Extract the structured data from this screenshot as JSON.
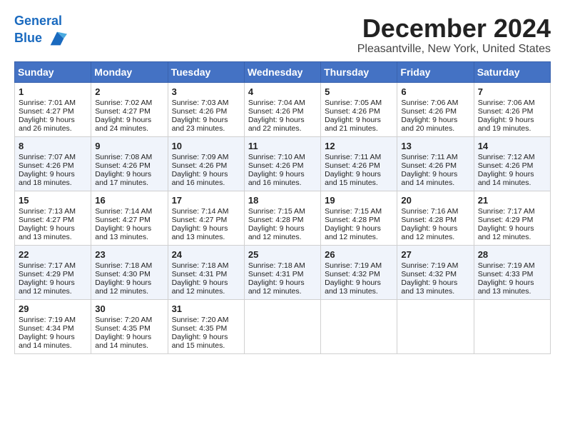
{
  "header": {
    "logo_line1": "General",
    "logo_line2": "Blue",
    "month_title": "December 2024",
    "location": "Pleasantville, New York, United States"
  },
  "days_of_week": [
    "Sunday",
    "Monday",
    "Tuesday",
    "Wednesday",
    "Thursday",
    "Friday",
    "Saturday"
  ],
  "weeks": [
    [
      {
        "day": "1",
        "sunrise": "Sunrise: 7:01 AM",
        "sunset": "Sunset: 4:27 PM",
        "daylight": "Daylight: 9 hours and 26 minutes."
      },
      {
        "day": "2",
        "sunrise": "Sunrise: 7:02 AM",
        "sunset": "Sunset: 4:27 PM",
        "daylight": "Daylight: 9 hours and 24 minutes."
      },
      {
        "day": "3",
        "sunrise": "Sunrise: 7:03 AM",
        "sunset": "Sunset: 4:26 PM",
        "daylight": "Daylight: 9 hours and 23 minutes."
      },
      {
        "day": "4",
        "sunrise": "Sunrise: 7:04 AM",
        "sunset": "Sunset: 4:26 PM",
        "daylight": "Daylight: 9 hours and 22 minutes."
      },
      {
        "day": "5",
        "sunrise": "Sunrise: 7:05 AM",
        "sunset": "Sunset: 4:26 PM",
        "daylight": "Daylight: 9 hours and 21 minutes."
      },
      {
        "day": "6",
        "sunrise": "Sunrise: 7:06 AM",
        "sunset": "Sunset: 4:26 PM",
        "daylight": "Daylight: 9 hours and 20 minutes."
      },
      {
        "day": "7",
        "sunrise": "Sunrise: 7:06 AM",
        "sunset": "Sunset: 4:26 PM",
        "daylight": "Daylight: 9 hours and 19 minutes."
      }
    ],
    [
      {
        "day": "8",
        "sunrise": "Sunrise: 7:07 AM",
        "sunset": "Sunset: 4:26 PM",
        "daylight": "Daylight: 9 hours and 18 minutes."
      },
      {
        "day": "9",
        "sunrise": "Sunrise: 7:08 AM",
        "sunset": "Sunset: 4:26 PM",
        "daylight": "Daylight: 9 hours and 17 minutes."
      },
      {
        "day": "10",
        "sunrise": "Sunrise: 7:09 AM",
        "sunset": "Sunset: 4:26 PM",
        "daylight": "Daylight: 9 hours and 16 minutes."
      },
      {
        "day": "11",
        "sunrise": "Sunrise: 7:10 AM",
        "sunset": "Sunset: 4:26 PM",
        "daylight": "Daylight: 9 hours and 16 minutes."
      },
      {
        "day": "12",
        "sunrise": "Sunrise: 7:11 AM",
        "sunset": "Sunset: 4:26 PM",
        "daylight": "Daylight: 9 hours and 15 minutes."
      },
      {
        "day": "13",
        "sunrise": "Sunrise: 7:11 AM",
        "sunset": "Sunset: 4:26 PM",
        "daylight": "Daylight: 9 hours and 14 minutes."
      },
      {
        "day": "14",
        "sunrise": "Sunrise: 7:12 AM",
        "sunset": "Sunset: 4:26 PM",
        "daylight": "Daylight: 9 hours and 14 minutes."
      }
    ],
    [
      {
        "day": "15",
        "sunrise": "Sunrise: 7:13 AM",
        "sunset": "Sunset: 4:27 PM",
        "daylight": "Daylight: 9 hours and 13 minutes."
      },
      {
        "day": "16",
        "sunrise": "Sunrise: 7:14 AM",
        "sunset": "Sunset: 4:27 PM",
        "daylight": "Daylight: 9 hours and 13 minutes."
      },
      {
        "day": "17",
        "sunrise": "Sunrise: 7:14 AM",
        "sunset": "Sunset: 4:27 PM",
        "daylight": "Daylight: 9 hours and 13 minutes."
      },
      {
        "day": "18",
        "sunrise": "Sunrise: 7:15 AM",
        "sunset": "Sunset: 4:28 PM",
        "daylight": "Daylight: 9 hours and 12 minutes."
      },
      {
        "day": "19",
        "sunrise": "Sunrise: 7:15 AM",
        "sunset": "Sunset: 4:28 PM",
        "daylight": "Daylight: 9 hours and 12 minutes."
      },
      {
        "day": "20",
        "sunrise": "Sunrise: 7:16 AM",
        "sunset": "Sunset: 4:28 PM",
        "daylight": "Daylight: 9 hours and 12 minutes."
      },
      {
        "day": "21",
        "sunrise": "Sunrise: 7:17 AM",
        "sunset": "Sunset: 4:29 PM",
        "daylight": "Daylight: 9 hours and 12 minutes."
      }
    ],
    [
      {
        "day": "22",
        "sunrise": "Sunrise: 7:17 AM",
        "sunset": "Sunset: 4:29 PM",
        "daylight": "Daylight: 9 hours and 12 minutes."
      },
      {
        "day": "23",
        "sunrise": "Sunrise: 7:18 AM",
        "sunset": "Sunset: 4:30 PM",
        "daylight": "Daylight: 9 hours and 12 minutes."
      },
      {
        "day": "24",
        "sunrise": "Sunrise: 7:18 AM",
        "sunset": "Sunset: 4:31 PM",
        "daylight": "Daylight: 9 hours and 12 minutes."
      },
      {
        "day": "25",
        "sunrise": "Sunrise: 7:18 AM",
        "sunset": "Sunset: 4:31 PM",
        "daylight": "Daylight: 9 hours and 12 minutes."
      },
      {
        "day": "26",
        "sunrise": "Sunrise: 7:19 AM",
        "sunset": "Sunset: 4:32 PM",
        "daylight": "Daylight: 9 hours and 13 minutes."
      },
      {
        "day": "27",
        "sunrise": "Sunrise: 7:19 AM",
        "sunset": "Sunset: 4:32 PM",
        "daylight": "Daylight: 9 hours and 13 minutes."
      },
      {
        "day": "28",
        "sunrise": "Sunrise: 7:19 AM",
        "sunset": "Sunset: 4:33 PM",
        "daylight": "Daylight: 9 hours and 13 minutes."
      }
    ],
    [
      {
        "day": "29",
        "sunrise": "Sunrise: 7:19 AM",
        "sunset": "Sunset: 4:34 PM",
        "daylight": "Daylight: 9 hours and 14 minutes."
      },
      {
        "day": "30",
        "sunrise": "Sunrise: 7:20 AM",
        "sunset": "Sunset: 4:35 PM",
        "daylight": "Daylight: 9 hours and 14 minutes."
      },
      {
        "day": "31",
        "sunrise": "Sunrise: 7:20 AM",
        "sunset": "Sunset: 4:35 PM",
        "daylight": "Daylight: 9 hours and 15 minutes."
      },
      {
        "day": "",
        "sunrise": "",
        "sunset": "",
        "daylight": ""
      },
      {
        "day": "",
        "sunrise": "",
        "sunset": "",
        "daylight": ""
      },
      {
        "day": "",
        "sunrise": "",
        "sunset": "",
        "daylight": ""
      },
      {
        "day": "",
        "sunrise": "",
        "sunset": "",
        "daylight": ""
      }
    ]
  ]
}
